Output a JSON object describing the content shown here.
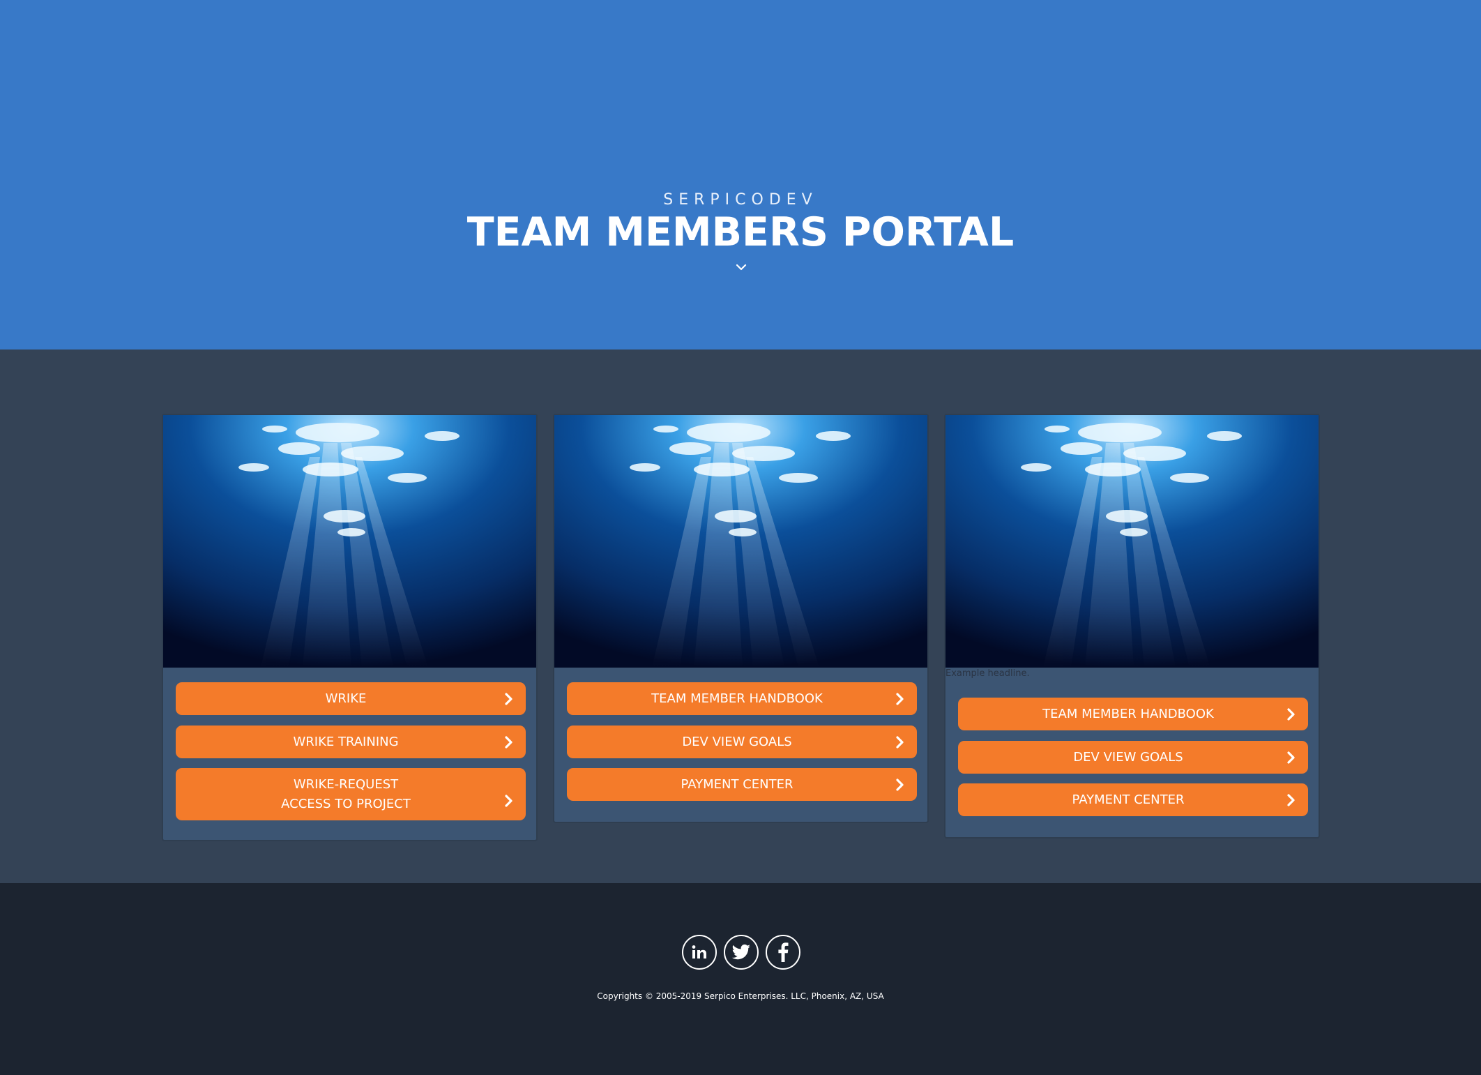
{
  "hero": {
    "brand": "SERPICODEV",
    "title": "TEAM MEMBERS PORTAL",
    "background_color": "#3879c8",
    "scroll_icon": "chevron-down-icon"
  },
  "cards": [
    {
      "image": "underwater-light-rays",
      "buttons": [
        {
          "label": "WRIKE"
        },
        {
          "label": "WRIKE TRAINING"
        },
        {
          "label_line1": "WRIKE-REQUEST",
          "label_line2": "ACCESS TO PROJECT"
        }
      ]
    },
    {
      "image": "underwater-light-rays",
      "buttons": [
        {
          "label": "TEAM MEMBER HANDBOOK"
        },
        {
          "label": "DEV VIEW GOALS"
        },
        {
          "label": "PAYMENT CENTER"
        }
      ]
    },
    {
      "image": "underwater-light-rays",
      "headline": "Example headline.",
      "buttons": [
        {
          "label": "TEAM MEMBER HANDBOOK"
        },
        {
          "label": "DEV VIEW GOALS"
        },
        {
          "label": "PAYMENT CENTER"
        }
      ]
    }
  ],
  "colors": {
    "button": "#f47b2a",
    "main_bg": "#344356",
    "card_bg": "#3c5573",
    "footer_bg": "#1c2430"
  },
  "footer": {
    "social": [
      "linkedin-icon",
      "twitter-icon",
      "facebook-icon"
    ],
    "copyright": "Copyrights © 2005-2019 Serpico Enterprises. LLC, Phoenix, AZ, USA"
  }
}
